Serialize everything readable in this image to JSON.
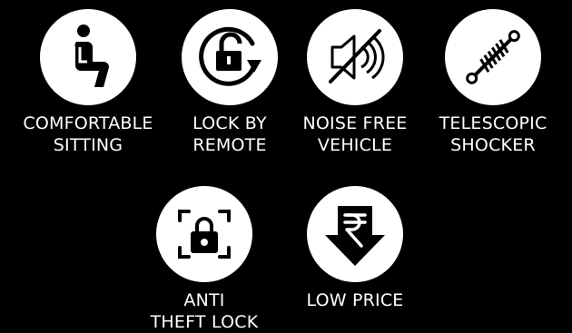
{
  "features": [
    {
      "icon": "person-sitting-icon",
      "line1": "COMFORTABLE",
      "line2": "SITTING"
    },
    {
      "icon": "remote-unlock-icon",
      "line1": "LOCK BY",
      "line2": "REMOTE"
    },
    {
      "icon": "speaker-muted-icon",
      "line1": "NOISE FREE",
      "line2": "VEHICLE"
    },
    {
      "icon": "shock-absorber-icon",
      "line1": "TELESCOPIC",
      "line2": "SHOCKER"
    },
    {
      "icon": "padlock-scan-icon",
      "line1": "ANTI",
      "line2": "THEFT LOCK"
    },
    {
      "icon": "rupee-down-arrow-icon",
      "line1": "LOW PRICE",
      "line2": ""
    }
  ],
  "colors": {
    "background": "#000000",
    "circle": "#ffffff",
    "icon": "#000000",
    "text": "#ffffff"
  }
}
